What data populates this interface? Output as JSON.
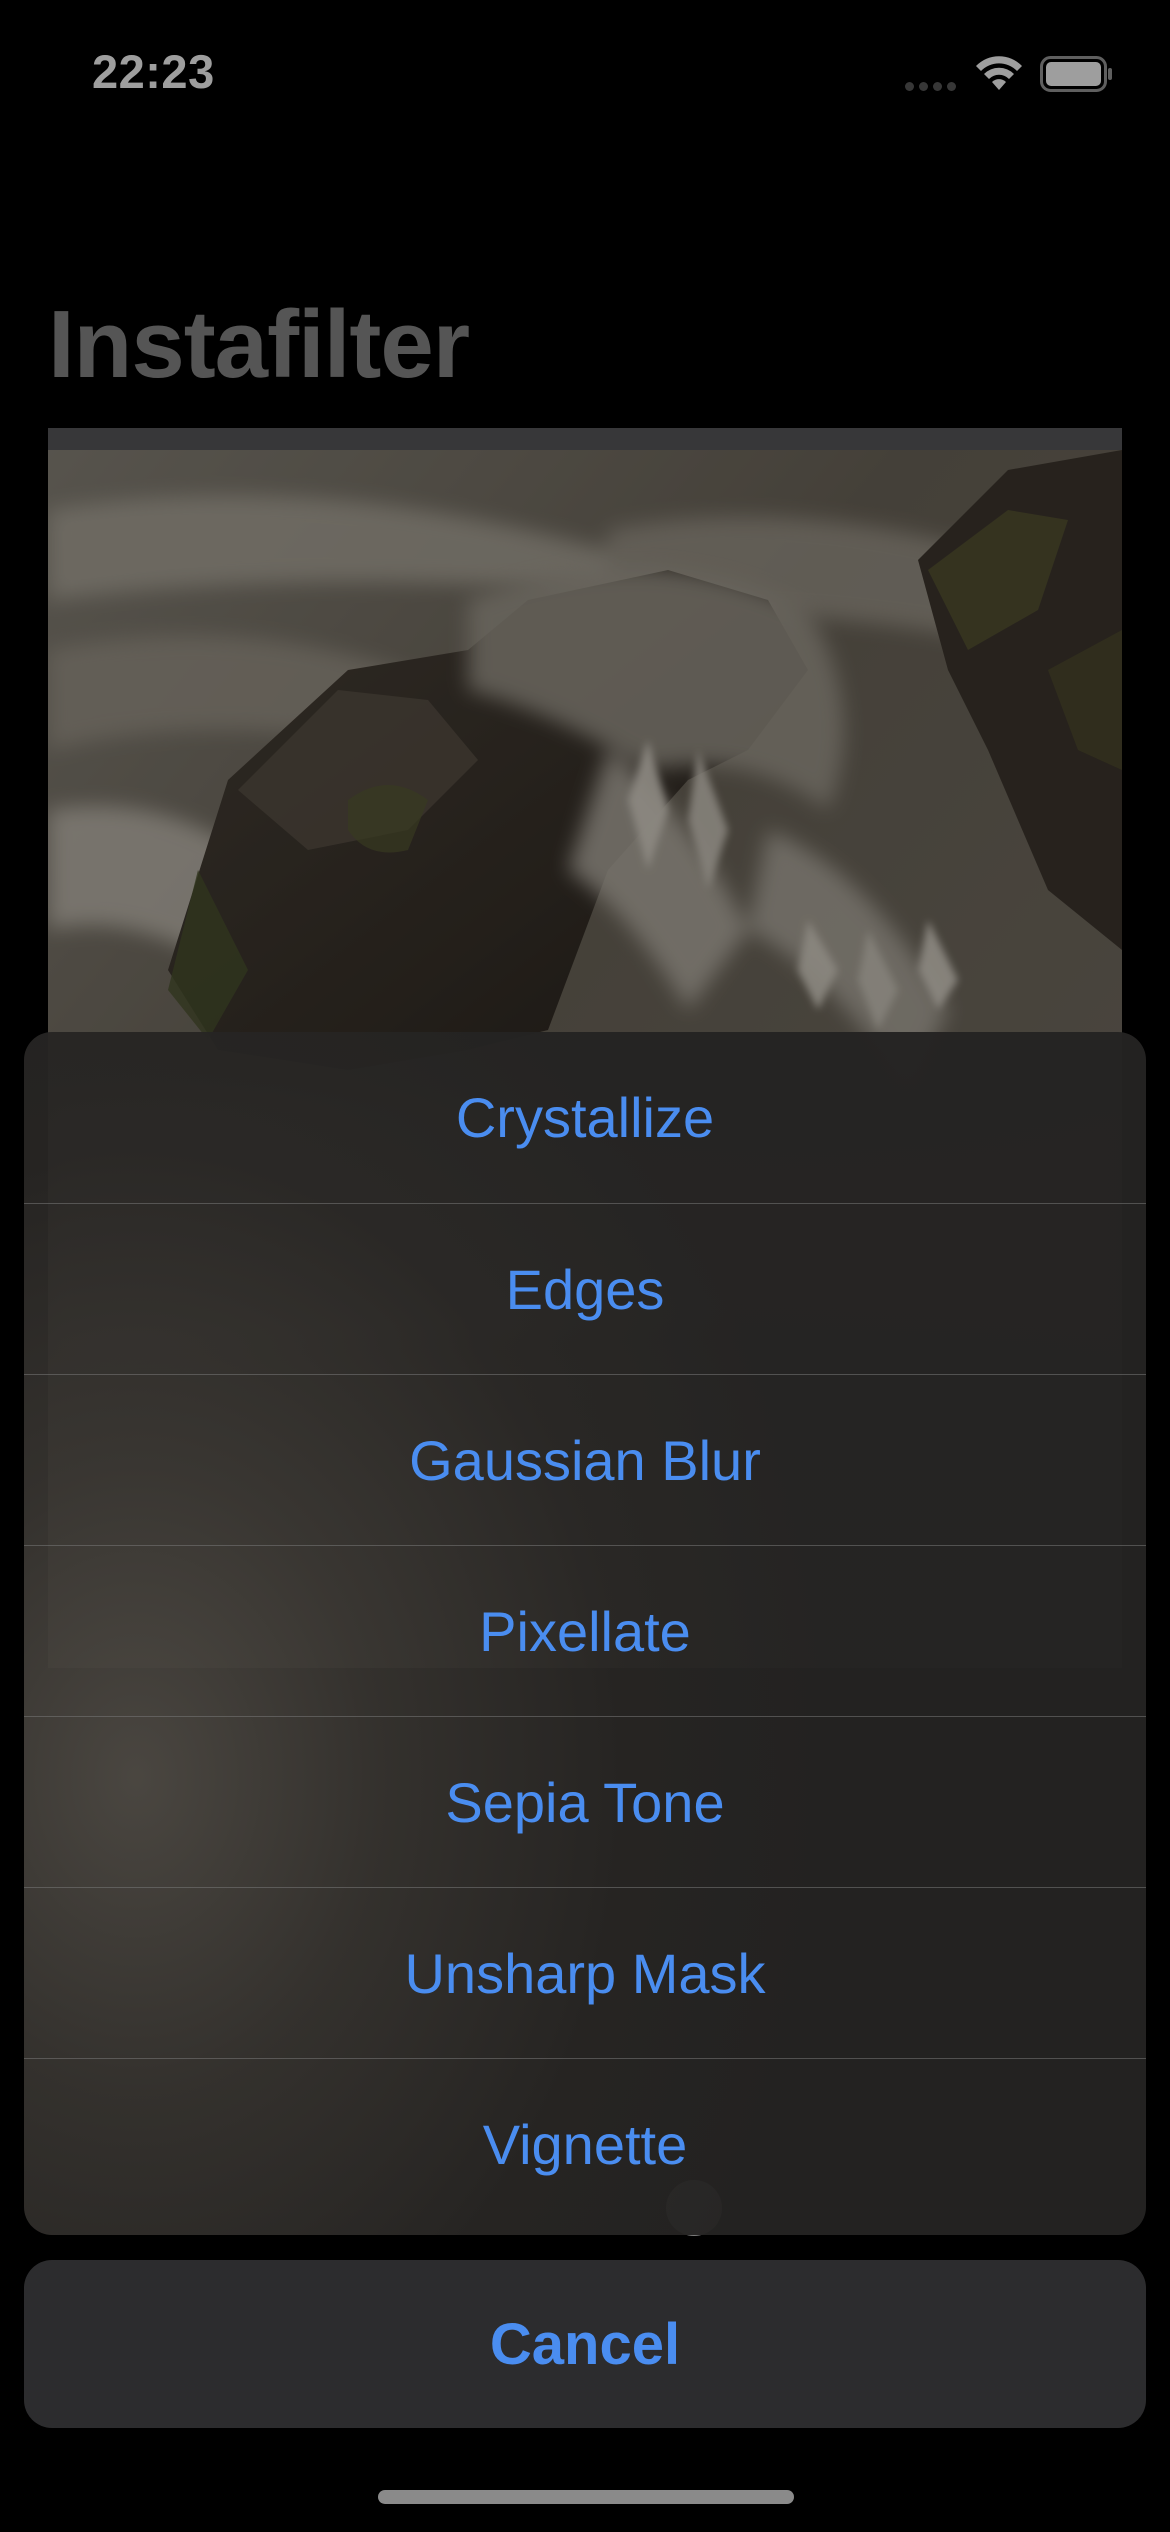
{
  "status_bar": {
    "time": "22:23",
    "wifi_icon": "wifi-icon",
    "battery_icon": "battery-icon"
  },
  "header": {
    "title": "Instafilter"
  },
  "action_sheet": {
    "items": [
      {
        "label": "Crystallize"
      },
      {
        "label": "Edges"
      },
      {
        "label": "Gaussian Blur"
      },
      {
        "label": "Pixellate"
      },
      {
        "label": "Sepia Tone"
      },
      {
        "label": "Unsharp Mask"
      },
      {
        "label": "Vignette"
      }
    ],
    "cancel_label": "Cancel"
  },
  "colors": {
    "accent": "#4a8df0",
    "title": "#8a8a8a",
    "background": "#000000"
  }
}
